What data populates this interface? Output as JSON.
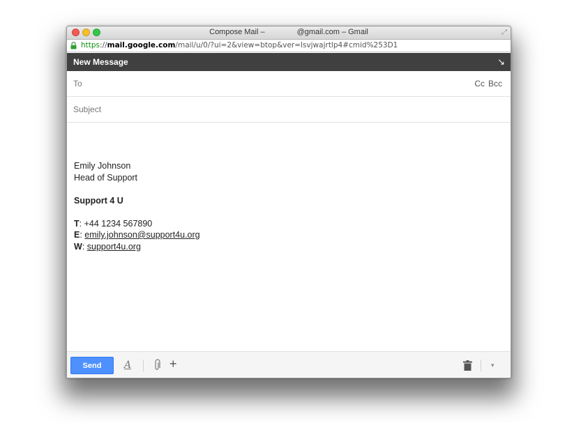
{
  "window": {
    "title_prefix": "Compose Mail –",
    "title_suffix": "@gmail.com – Gmail",
    "url_scheme": "https",
    "url_sep": "://",
    "url_host": "mail.google.com",
    "url_path": "/mail/u/0/?ui=2&view=btop&ver=lsvjwajrtlp4#cmid%253D1"
  },
  "compose": {
    "title": "New Message",
    "popout_glyph": "↘",
    "to_label": "To",
    "cc_label": "Cc",
    "bcc_label": "Bcc",
    "subject_placeholder": "Subject"
  },
  "signature": {
    "name": "Emily Johnson",
    "role": "Head of Support",
    "company": "Support 4 U",
    "phone_label": "T",
    "phone": "+44 1234 567890",
    "email_label": "E",
    "email": "emily.johnson@support4u.org",
    "web_label": "W",
    "web": "support4u.org"
  },
  "toolbar": {
    "send_label": "Send",
    "format_glyph": "A",
    "plus_glyph": "+",
    "more_glyph": "▾"
  },
  "icons": [
    "lock-icon",
    "popout-icon",
    "format-text-icon",
    "attach-icon",
    "insert-more-icon",
    "trash-icon",
    "more-options-icon"
  ],
  "colors": {
    "send_button": "#4d90fe",
    "compose_header": "#404040",
    "url_scheme": "#109010"
  }
}
